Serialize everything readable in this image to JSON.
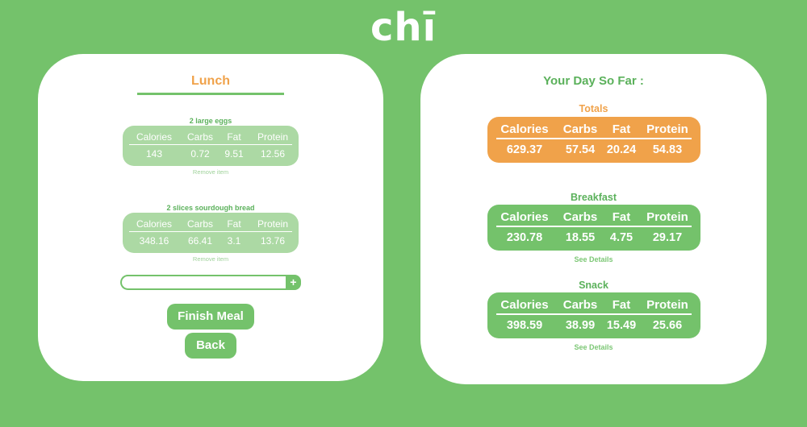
{
  "app": {
    "logo": "chī"
  },
  "meal": {
    "title": "Lunch",
    "columns": [
      "Calories",
      "Carbs",
      "Fat",
      "Protein"
    ],
    "items": [
      {
        "name": "2 large eggs",
        "calories": "143",
        "carbs": "0.72",
        "fat": "9.51",
        "protein": "12.56",
        "remove_label": "Remove item"
      },
      {
        "name": "2 slices sourdough bread",
        "calories": "348.16",
        "carbs": "66.41",
        "fat": "3.1",
        "protein": "13.76",
        "remove_label": "Remove item"
      }
    ],
    "add_input": {
      "value": "",
      "placeholder": ""
    },
    "add_button_label": "+",
    "finish_label": "Finish Meal",
    "back_label": "Back"
  },
  "day": {
    "title": "Your Day So Far :",
    "columns": [
      "Calories",
      "Carbs",
      "Fat",
      "Protein"
    ],
    "summaries": [
      {
        "title": "Totals",
        "calories": "629.37",
        "carbs": "57.54",
        "fat": "20.24",
        "protein": "54.83",
        "link": ""
      },
      {
        "title": "Breakfast",
        "calories": "230.78",
        "carbs": "18.55",
        "fat": "4.75",
        "protein": "29.17",
        "link": "See Details"
      },
      {
        "title": "Snack",
        "calories": "398.59",
        "carbs": "38.99",
        "fat": "15.49",
        "protein": "25.66",
        "link": "See Details"
      }
    ]
  },
  "colors": {
    "background": "#74c26b",
    "accent_orange": "#f0a24a",
    "item_card": "#acd9a4",
    "panel": "#ffffff"
  }
}
